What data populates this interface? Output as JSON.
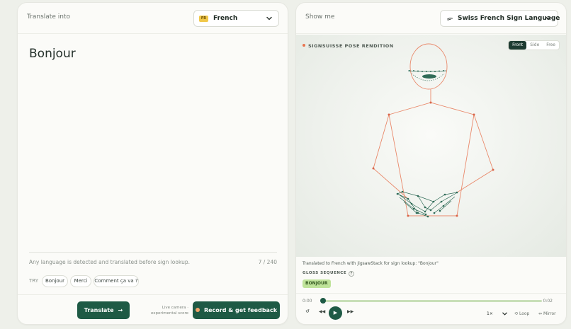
{
  "left": {
    "header_label": "Translate into",
    "language": {
      "code": "FR",
      "name": "French"
    },
    "input_text": "Bonjour",
    "hint": "Any language is detected and translated before sign lookup.",
    "char_count": "7 / 240",
    "try_label": "TRY",
    "suggestions": [
      "Bonjour",
      "Merci",
      "Comment ça va ?"
    ],
    "translate_label": "Translate",
    "note": "Live camera · experimental score",
    "record_label": "Record & get feedback"
  },
  "right": {
    "header_label": "Show me",
    "sign_language": "Swiss French Sign Language",
    "stage_title": "SIGNSUISSE POSE RENDITION",
    "views": [
      "Front",
      "Side",
      "Free"
    ],
    "active_view": "Front",
    "info": "Translated to French with JigsawStack for sign lookup: \"Bonjour\"",
    "gloss_label": "GLOSS SEQUENCE",
    "gloss": [
      "BONJOUR"
    ],
    "time_start": "0:00",
    "time_end": "0:02",
    "progress": 0.0,
    "speed": "1×",
    "loop_label": "Loop",
    "mirror_label": "Mirror"
  },
  "colors": {
    "accent": "#1e5a45",
    "gloss_badge": "#bfe39a",
    "skeleton_body": "#e9896b",
    "skeleton_hand": "#2f6b57",
    "flag": "#f1c84a"
  },
  "icons": [
    "chevron-down-icon",
    "hand-icon",
    "arrow-right-icon",
    "record-dot-icon",
    "help-icon",
    "restart-icon",
    "rewind-icon",
    "play-icon",
    "forward-icon",
    "loop-icon",
    "mirror-icon"
  ]
}
